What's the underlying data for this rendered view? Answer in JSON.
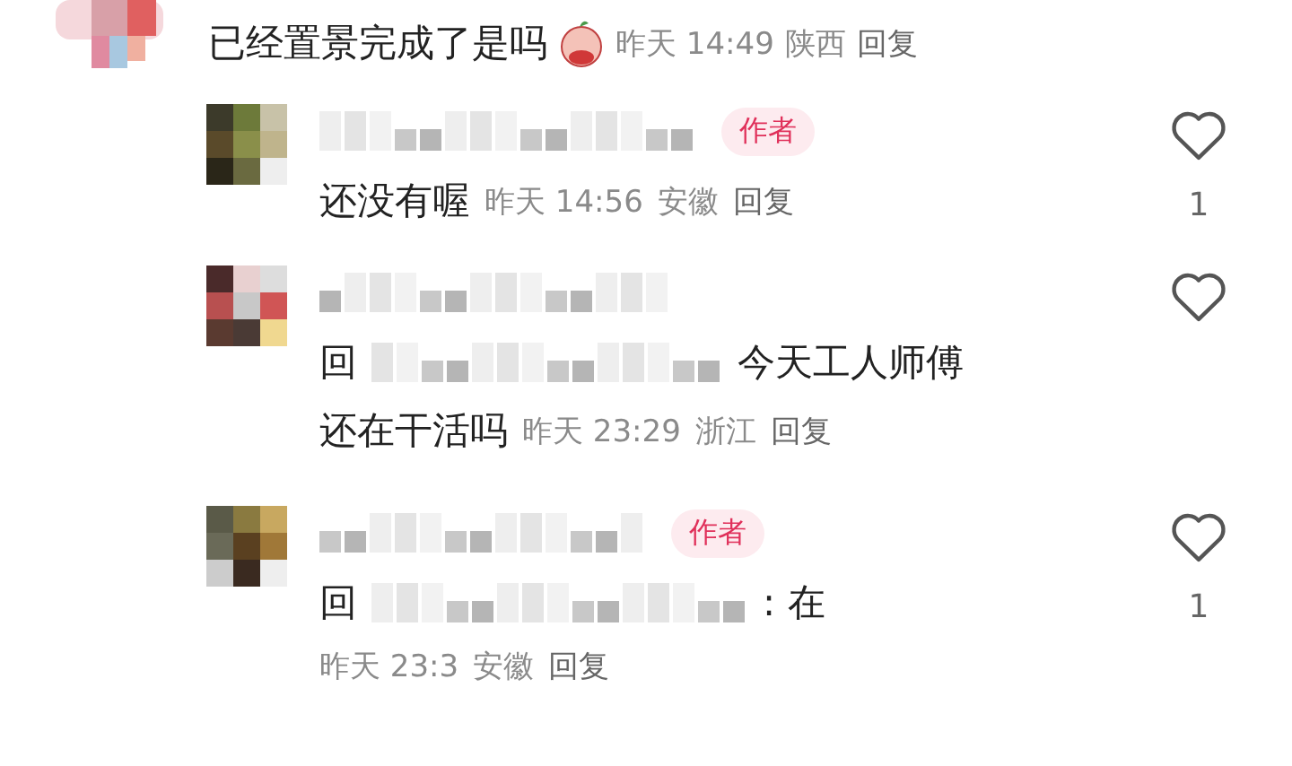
{
  "top_comment": {
    "text": "已经置景完成了是吗",
    "time": "昨天 14:49",
    "location": "陕西",
    "reply_action": "回复"
  },
  "replies": [
    {
      "badge": "作者",
      "body": [
        {
          "kind": "text",
          "text": "还没有喔"
        }
      ],
      "time": "昨天 14:56",
      "location": "安徽",
      "reply_action": "回复",
      "like_count": "1",
      "meta_own_line": false
    },
    {
      "body": [
        {
          "kind": "mention",
          "prefix": "回",
          "suffix": "今天工人师傅"
        },
        {
          "kind": "text",
          "text": "还在干活吗"
        }
      ],
      "time": "昨天 23:29",
      "location": "浙江",
      "reply_action": "回复",
      "meta_own_line": false
    },
    {
      "badge": "作者",
      "body": [
        {
          "kind": "mention",
          "prefix": "回",
          "suffix": ": 在"
        }
      ],
      "time": "昨天 23:3",
      "location": "安徽",
      "reply_action": "回复",
      "like_count": "1",
      "meta_own_line": true
    }
  ]
}
